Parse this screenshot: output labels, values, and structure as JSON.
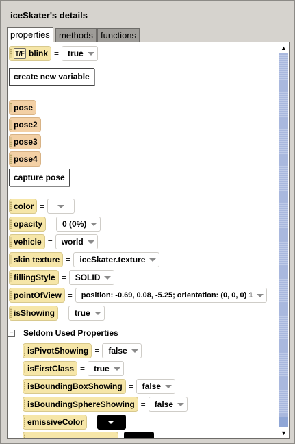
{
  "window": {
    "title": "iceSkater's details"
  },
  "tabs": [
    {
      "label": "properties",
      "active": true
    },
    {
      "label": "methods",
      "active": false
    },
    {
      "label": "functions",
      "active": false
    }
  ],
  "variables": {
    "blink": {
      "label": "blink",
      "value": "true",
      "type_badge": "T/F"
    }
  },
  "buttons": {
    "create_variable": "create new variable",
    "capture_pose": "capture pose"
  },
  "poses": [
    "pose",
    "pose2",
    "pose3",
    "pose4"
  ],
  "properties": [
    {
      "label": "color",
      "value": ""
    },
    {
      "label": "opacity",
      "value": "0 (0%)"
    },
    {
      "label": "vehicle",
      "value": "world"
    },
    {
      "label": "skin texture",
      "value": "iceSkater.texture"
    },
    {
      "label": "fillingStyle",
      "value": "SOLID"
    },
    {
      "label": "pointOfView",
      "value": "position: -0.69, 0.08, -5.25;  orientation: (0, 0, 0) 1"
    },
    {
      "label": "isShowing",
      "value": "true"
    }
  ],
  "seldom": {
    "header": "Seldom Used Properties",
    "items": [
      {
        "label": "isPivotShowing",
        "value": "false"
      },
      {
        "label": "isFirstClass",
        "value": "true"
      },
      {
        "label": "isBoundingBoxShowing",
        "value": "false"
      },
      {
        "label": "isBoundingSphereShowing",
        "value": "false"
      },
      {
        "label": "emissiveColor",
        "value": ""
      }
    ]
  },
  "colors": {
    "tile": "#f6e6a8",
    "pose_tile": "#f3d0a5",
    "scroll_track": "#8fa6d6",
    "background": "#d6d3ce"
  }
}
